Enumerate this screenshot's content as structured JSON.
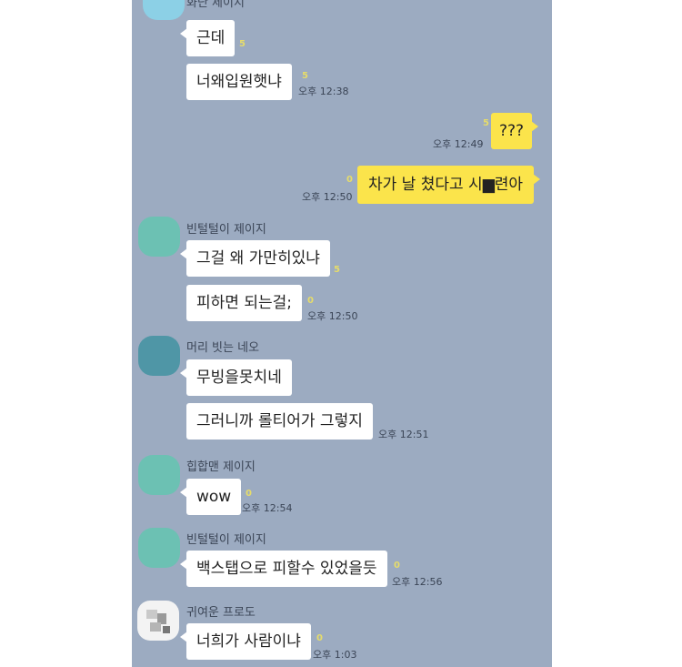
{
  "header": {
    "partial_name": "화단 제이지"
  },
  "messages": [
    {
      "text": "근데",
      "unread": "5"
    },
    {
      "text": "너왜입원햇냐",
      "unread": "5",
      "time": "오후 12:38"
    },
    {
      "text": "???",
      "unread": "5",
      "time": "오후 12:49"
    },
    {
      "text": "차가 날 쳤다고 시▆련아",
      "unread": "0",
      "time": "오후 12:50"
    },
    {
      "sender": "빈털털이 제이지",
      "text": "그걸 왜 가만히있냐",
      "unread": "5"
    },
    {
      "text": "피하면 되는걸;",
      "unread": "0",
      "time": "오후 12:50"
    },
    {
      "sender": "머리 빗는 네오",
      "text": "무빙을못치네",
      "unread": ""
    },
    {
      "text": "그러니까 롤티어가 그렇지",
      "unread": "",
      "time": "오후 12:51"
    },
    {
      "sender": "힙합맨 제이지",
      "text": "wow",
      "unread": "0",
      "time": "오후 12:54"
    },
    {
      "sender": "빈털털이 제이지",
      "text": "백스탭으로 피할수 있었을듯",
      "unread": "0",
      "time": "오후 12:56"
    },
    {
      "sender": "귀여운 프로도",
      "text": "너희가 사람이냐",
      "unread": "0",
      "time": "오후 1:03"
    }
  ],
  "colors": {
    "chat_background": "#9cabc1",
    "my_bubble": "#fbe44b",
    "other_bubble": "#ffffff",
    "avatar_teal": "#6cc1b3",
    "avatar_dark_teal": "#4f96a6",
    "avatar_top": "#8cd0e6"
  }
}
